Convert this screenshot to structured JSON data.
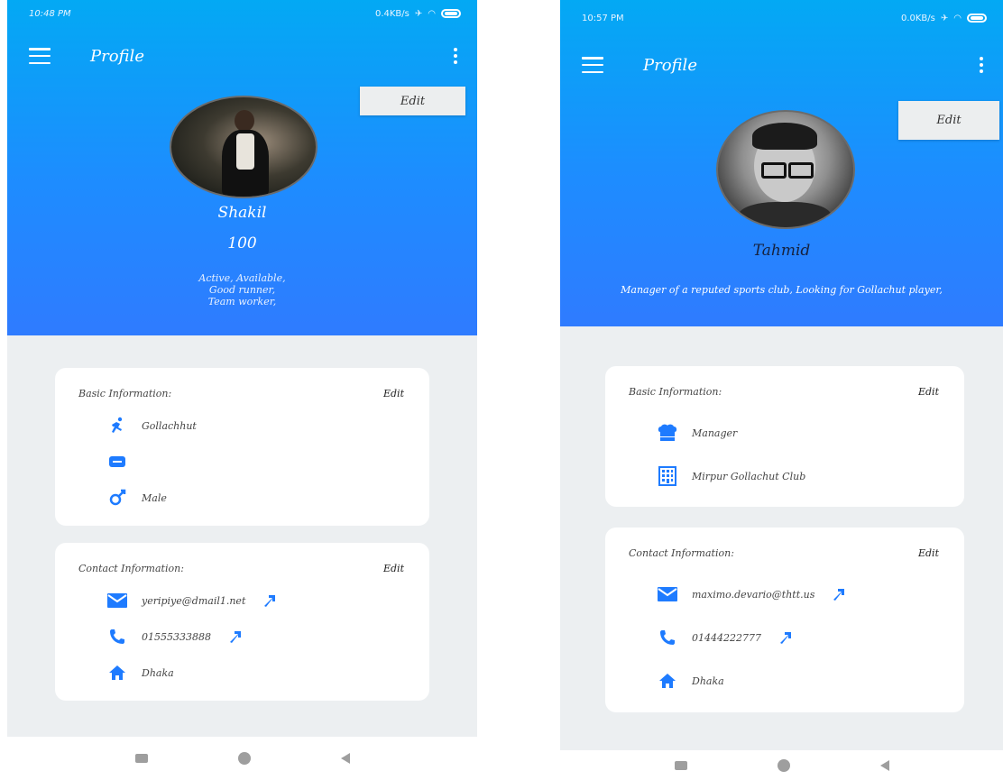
{
  "left": {
    "status": {
      "time": "10:48 PM",
      "speed": "0.4KB/s"
    },
    "appbar": {
      "title": "Profile"
    },
    "edit_label": "Edit",
    "profile": {
      "name": "Shakil",
      "points": "100",
      "bio_lines": [
        "Active, Available,",
        "Good runner,",
        "Team worker,"
      ]
    },
    "basic": {
      "title": "Basic Information:",
      "edit": "Edit",
      "items": [
        {
          "icon": "runner-icon",
          "text": "Gollachhut"
        },
        {
          "icon": "id-card-icon",
          "text": ""
        },
        {
          "icon": "gender-icon",
          "text": "Male"
        }
      ]
    },
    "contact": {
      "title": "Contact Information:",
      "edit": "Edit",
      "items": [
        {
          "icon": "email-icon",
          "text": "yeripiye@dmail1.net"
        },
        {
          "icon": "phone-icon",
          "text": "01555333888"
        },
        {
          "icon": "home-icon",
          "text": "Dhaka"
        }
      ]
    }
  },
  "right": {
    "status": {
      "time": "10:57 PM",
      "speed": "0.0KB/s"
    },
    "appbar": {
      "title": "Profile"
    },
    "edit_label": "Edit",
    "profile": {
      "name": "Tahmid",
      "bio": "Manager of a reputed sports club, Looking for Gollachut player,"
    },
    "basic": {
      "title": "Basic Information:",
      "edit": "Edit",
      "items": [
        {
          "icon": "chef-hat-icon",
          "text": "Manager"
        },
        {
          "icon": "building-icon",
          "text": "Mirpur Gollachut Club"
        }
      ]
    },
    "contact": {
      "title": "Contact Information:",
      "edit": "Edit",
      "items": [
        {
          "icon": "email-icon",
          "text": "maximo.devario@thtt.us"
        },
        {
          "icon": "phone-icon",
          "text": "01444222777"
        },
        {
          "icon": "home-icon",
          "text": "Dhaka"
        }
      ]
    }
  },
  "colors": {
    "accent": "#1e7bff",
    "header_top": "#03a9f4",
    "header_bottom": "#2f7bff",
    "background": "#eceff1"
  }
}
